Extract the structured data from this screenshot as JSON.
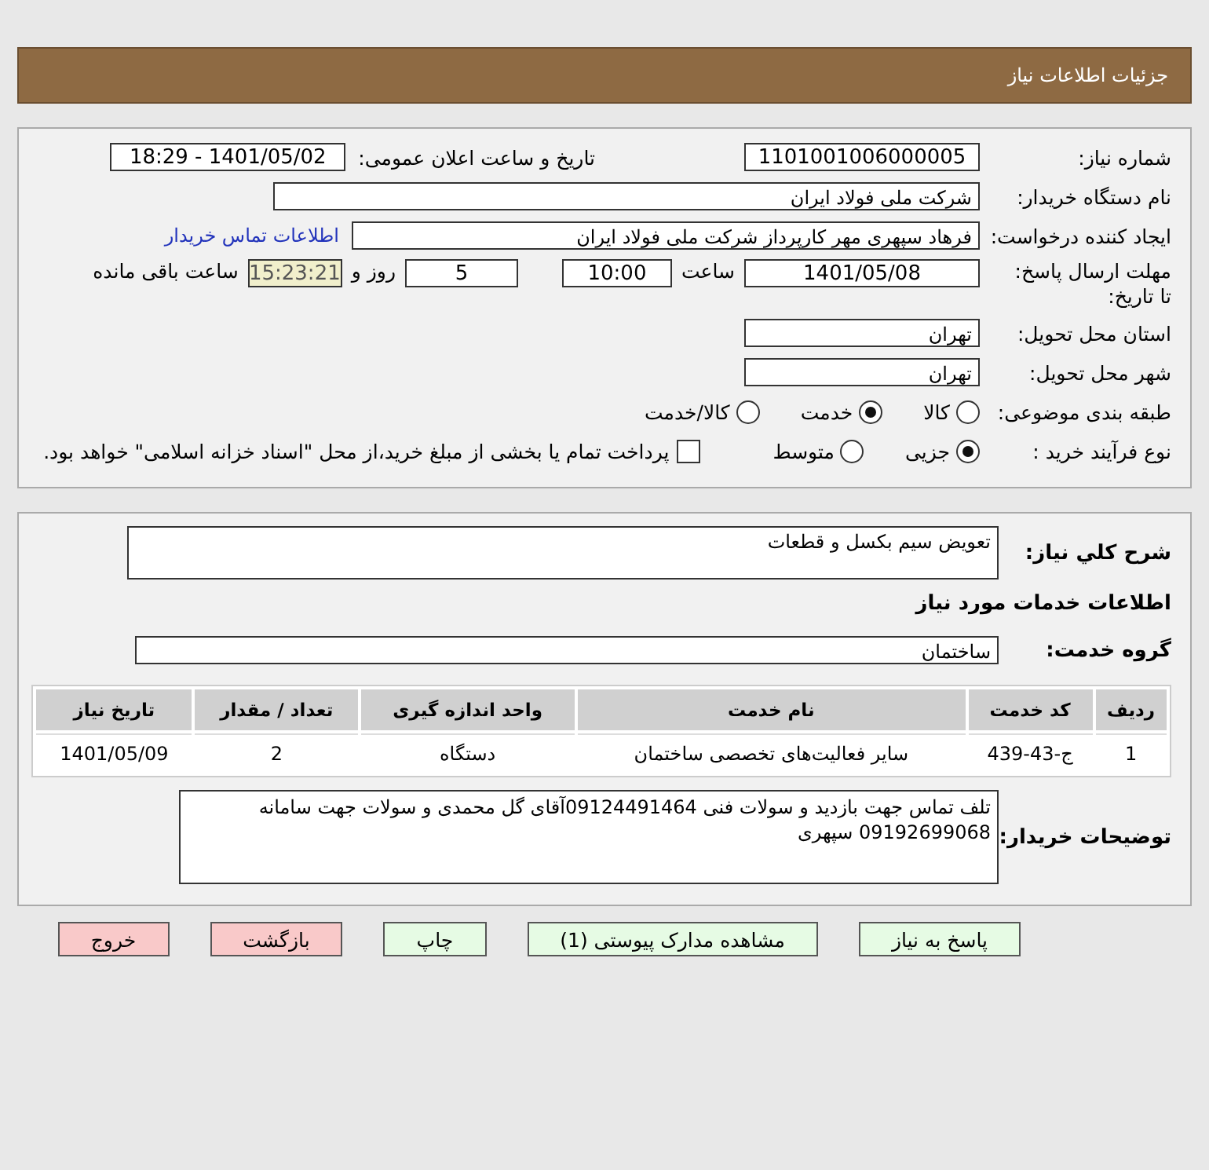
{
  "header": {
    "title": "جزئیات اطلاعات نیاز"
  },
  "details": {
    "need_number": {
      "label": "شماره نیاز:",
      "value": "1101001006000005"
    },
    "announce": {
      "label": "تاریخ و ساعت اعلان عمومی:",
      "value": "1401/05/02 - 18:29"
    },
    "buyer": {
      "label": "نام دستگاه خریدار:",
      "value": "شرکت ملی فولاد ایران"
    },
    "creator": {
      "label": "ایجاد کننده درخواست:",
      "value": "فرهاد سپهری مهر کارپرداز شرکت ملی فولاد ایران",
      "link": "اطلاعات تماس خریدار"
    },
    "deadline": {
      "label": "مهلت ارسال پاسخ: تا تاریخ:",
      "date": "1401/05/08",
      "time_label": "ساعت",
      "time": "10:00",
      "days": "5",
      "days_label": "روز و",
      "remaining": "15:23:21",
      "remaining_label": "ساعت باقی مانده"
    },
    "province": {
      "label": "استان محل تحویل:",
      "value": "تهران"
    },
    "city": {
      "label": "شهر محل تحویل:",
      "value": "تهران"
    },
    "category": {
      "label": "طبقه بندی موضوعی:",
      "options": [
        {
          "label": "کالا",
          "selected": false
        },
        {
          "label": "خدمت",
          "selected": true
        },
        {
          "label": "کالا/خدمت",
          "selected": false
        }
      ]
    },
    "process": {
      "label": "نوع فرآیند خرید :",
      "options": [
        {
          "label": "جزیی",
          "selected": true
        },
        {
          "label": "متوسط",
          "selected": false
        }
      ],
      "treasury": {
        "label": "پرداخت تمام یا بخشی از مبلغ خرید،از محل \"اسناد خزانه اسلامی\" خواهد بود.",
        "checked": false
      }
    }
  },
  "services": {
    "summary": {
      "label": "شرح كلي نياز:",
      "value": "تعویض سیم بکسل و قطعات"
    },
    "heading": "اطلاعات خدمات مورد نیاز",
    "group": {
      "label": "گروه خدمت:",
      "value": "ساختمان"
    },
    "table": {
      "columns": [
        "ردیف",
        "کد خدمت",
        "نام خدمت",
        "واحد اندازه گیری",
        "تعداد / مقدار",
        "تاریخ نیاز"
      ],
      "rows": [
        [
          "1",
          "ج-43-439",
          "سایر فعالیت‌های تخصصی ساختمان",
          "دستگاه",
          "2",
          "1401/05/09"
        ]
      ]
    },
    "notes": {
      "label": "توضیحات خریدار:",
      "value": "تلف تماس جهت بازدید و سولات فنی 09124491464آقای گل محمدی و سولات جهت سامانه 09192699068 سپهری"
    }
  },
  "buttons": [
    {
      "label": "پاسخ به نیاز",
      "kind": "primary"
    },
    {
      "label": "مشاهده مدارک پیوستی (1)",
      "kind": "primary"
    },
    {
      "label": "چاپ",
      "kind": "primary"
    },
    {
      "label": "بازگشت",
      "kind": "danger"
    },
    {
      "label": "خروج",
      "kind": "danger"
    }
  ]
}
